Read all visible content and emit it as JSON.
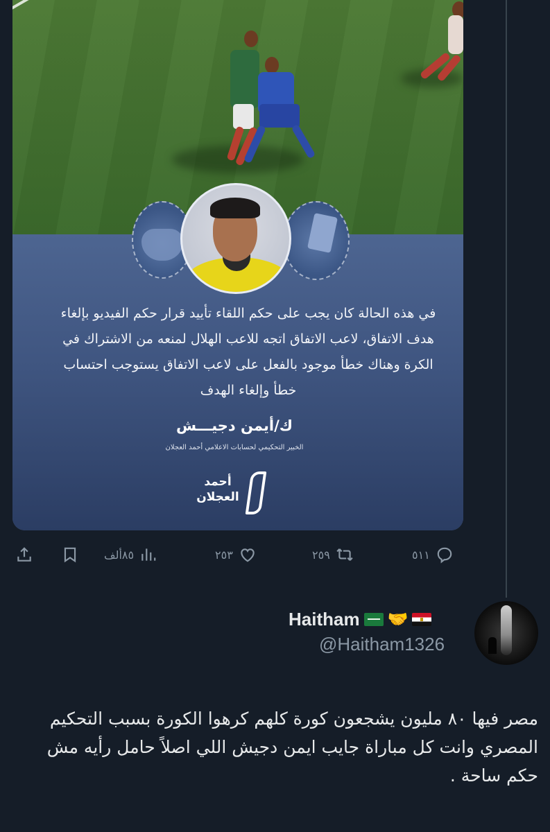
{
  "tweet_media": {
    "quote": "في هذه الحالة كان يجب على حكم اللقاء تأييد قرار حكم الفيديو بإلغاء هدف الاتفاق، لاعب الاتفاق اتجه للاعب الهلال لمنعه من الاشتراك في الكرة وهناك خطأ موجود بالفعل على لاعب الاتفاق يستوجب احتساب خطأ وإلغاء الهدف",
    "author": "ك/أيمن دجيـــش",
    "author_title": "الخبير التحكيمي لحسابات الاعلامي أحمد العجلان",
    "brand": "أحمد العجلان"
  },
  "actions": {
    "replies": "٥١١",
    "retweets": "٢٥٩",
    "likes": "٢٥٣",
    "views": "٨٥ألف"
  },
  "reply": {
    "display_name": "Haitham",
    "handle": "@Haitham1326",
    "text": "مصر فيها ٨٠ مليون يشجعون كورة كلهم كرهوا الكورة بسبب التحكيم المصري وانت كل مباراة جايب ايمن دجيش اللي اصلاً حامل رأيه مش حكم ساحة ."
  },
  "colors": {
    "background": "#151d28",
    "text_primary": "#e7e9ea",
    "text_secondary": "#8b98a5"
  }
}
